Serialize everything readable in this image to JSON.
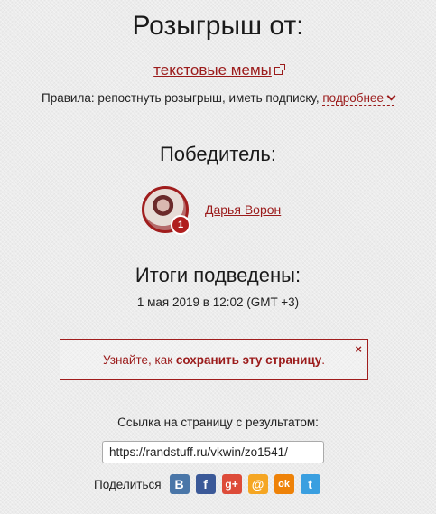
{
  "header": {
    "title": "Розыгрыш от:",
    "organizer_link": "текстовые мемы",
    "rules_text": "Правила: репостнуть розыгрыш, иметь подписку, ",
    "rules_more": "подробнее"
  },
  "winner": {
    "heading": "Победитель:",
    "name": "Дарья Ворон",
    "badge": "1"
  },
  "results": {
    "heading": "Итоги подведены:",
    "date": "1 мая 2019 в 12:02 (GMT +3)"
  },
  "notice": {
    "text_before": "Узнайте, как ",
    "text_bold": "сохранить эту страницу",
    "text_after": ".",
    "close": "×"
  },
  "link": {
    "label": "Ссылка на страницу с результатом:",
    "url": "https://randstuff.ru/vkwin/zo1541/"
  },
  "share": {
    "label": "Поделиться",
    "buttons": [
      {
        "icon": "vk-icon",
        "glyph": "B",
        "color": "#4a76a8"
      },
      {
        "icon": "facebook-icon",
        "glyph": "f",
        "color": "#3b5998"
      },
      {
        "icon": "google-plus-icon",
        "glyph": "g+",
        "color": "#dd4b39"
      },
      {
        "icon": "mail-icon",
        "glyph": "@",
        "color": "#f5a623"
      },
      {
        "icon": "odnoklassniki-icon",
        "glyph": "ok",
        "color": "#ee8208"
      },
      {
        "icon": "twitter-icon",
        "glyph": "t",
        "color": "#3a9fe0"
      }
    ]
  }
}
